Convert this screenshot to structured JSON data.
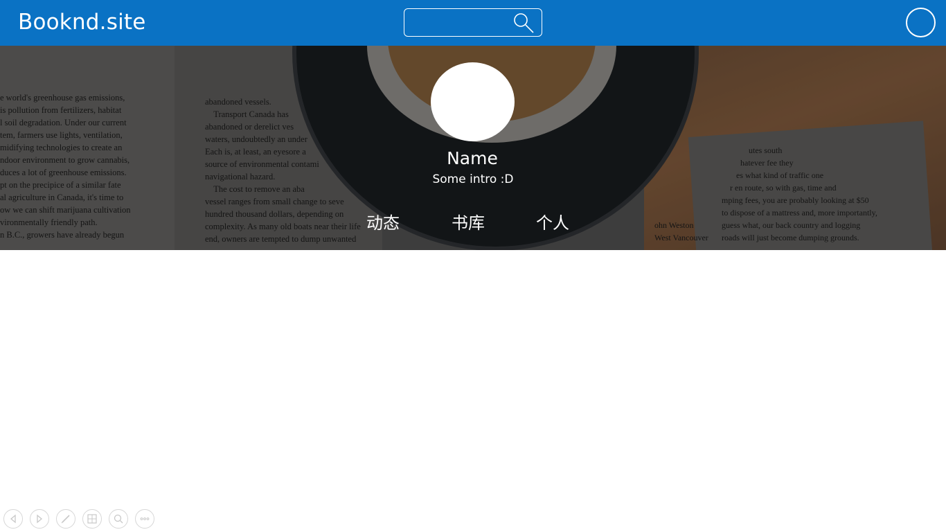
{
  "header": {
    "brand": "Booknd.site",
    "search": {
      "value": "",
      "placeholder": ""
    }
  },
  "banner": {
    "news_left": "e world's greenhouse gas emissions,\nis pollution from fertilizers, habitat\nl soil degradation. Under our current\ntem, farmers use lights, ventilation,\nmidifying technologies to create an\nndoor environment to grow cannabis,\nduces a lot of greenhouse emissions.\npt on the precipice of a similar fate\nal agriculture in Canada, it's time to\now we can shift marijuana cultivation\nvironmentally friendly path.\nn B.C., growers have already begun",
    "news_mid": "abandoned vessels.\n    Transport Canada has\nabandoned or derelict ves\nwaters, undoubtedly an under\nEach is, at least, an eyesore a\nsource of environmental contami\nnavigational hazard.\n    The cost to remove an aba\nvessel ranges from small change to seve\nhundred thousand dollars, depending on\ncomplexity. As many old boats near their life\nend, owners are tempted to dump unwanted",
    "news_right": "             utes south\n         hatever fee they\n       es what kind of traffic one\n    r en route, so with gas, time and\nmping fees, you are probably looking at $50\nto dispose of a mattress and, more importantly,\nguess what, our back country and logging\nroads will just become dumping grounds.",
    "news_right_small": "ohn Weston\nWest Vancouver"
  },
  "profile": {
    "name": "Name",
    "intro": "Some intro :D"
  },
  "tabs": [
    "动态",
    "书库",
    "个人"
  ],
  "bottom_tools": [
    "prev-icon",
    "next-icon",
    "pen-icon",
    "grid-icon",
    "zoom-icon",
    "more-icon"
  ]
}
